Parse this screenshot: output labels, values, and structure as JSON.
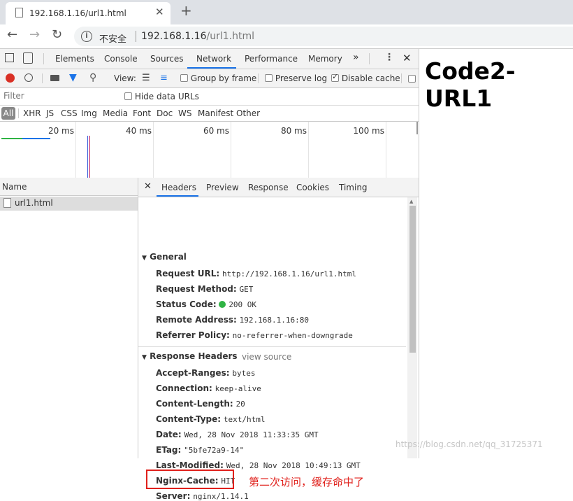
{
  "browser": {
    "tab_title": "192.168.1.16/url1.html",
    "security_label": "不安全",
    "url_host": "192.168.1.16",
    "url_path": "/url1.html"
  },
  "devtools": {
    "tabs": [
      "Elements",
      "Console",
      "Sources",
      "Network",
      "Performance",
      "Memory"
    ],
    "active_tab": "Network",
    "more_tabs": "»",
    "view_label": "View:",
    "group_by_frame": "Group by frame",
    "preserve_log": "Preserve log",
    "disable_cache": "Disable cache",
    "filter_placeholder": "Filter",
    "hide_data_urls": "Hide data URLs",
    "filter_types": [
      "All",
      "XHR",
      "JS",
      "CSS",
      "Img",
      "Media",
      "Font",
      "Doc",
      "WS",
      "Manifest",
      "Other"
    ],
    "timeline_ticks": [
      "20 ms",
      "40 ms",
      "60 ms",
      "80 ms",
      "100 ms"
    ],
    "name_header": "Name",
    "request_name": "url1.html",
    "detail_tabs": [
      "Headers",
      "Preview",
      "Response",
      "Cookies",
      "Timing"
    ],
    "general": {
      "title": "General",
      "rows": [
        {
          "k": "Request URL:",
          "v": "http://192.168.1.16/url1.html"
        },
        {
          "k": "Request Method:",
          "v": "GET"
        },
        {
          "k": "Status Code:",
          "v": "200 OK"
        },
        {
          "k": "Remote Address:",
          "v": "192.168.1.16:80"
        },
        {
          "k": "Referrer Policy:",
          "v": "no-referrer-when-downgrade"
        }
      ]
    },
    "response_headers": {
      "title": "Response Headers",
      "view_source": "view source",
      "rows": [
        {
          "k": "Accept-Ranges:",
          "v": "bytes"
        },
        {
          "k": "Connection:",
          "v": "keep-alive"
        },
        {
          "k": "Content-Length:",
          "v": "20"
        },
        {
          "k": "Content-Type:",
          "v": "text/html"
        },
        {
          "k": "Date:",
          "v": "Wed, 28 Nov 2018 11:33:35 GMT"
        },
        {
          "k": "ETag:",
          "v": "\"5bfe72a9-14\""
        },
        {
          "k": "Last-Modified:",
          "v": "Wed, 28 Nov 2018 10:49:13 GMT"
        },
        {
          "k": "Nginx-Cache:",
          "v": "HIT"
        },
        {
          "k": "Server:",
          "v": "nginx/1.14.1"
        }
      ]
    }
  },
  "annotation": "第二次访问，缓存命中了",
  "page": {
    "heading": "Code2-URL1"
  },
  "watermark": "https://blog.csdn.net/qq_31725371",
  "colors": {
    "accent": "#1a73e8",
    "record": "#d93025",
    "status_ok": "#2fb344",
    "annotation": "#e0201b"
  }
}
